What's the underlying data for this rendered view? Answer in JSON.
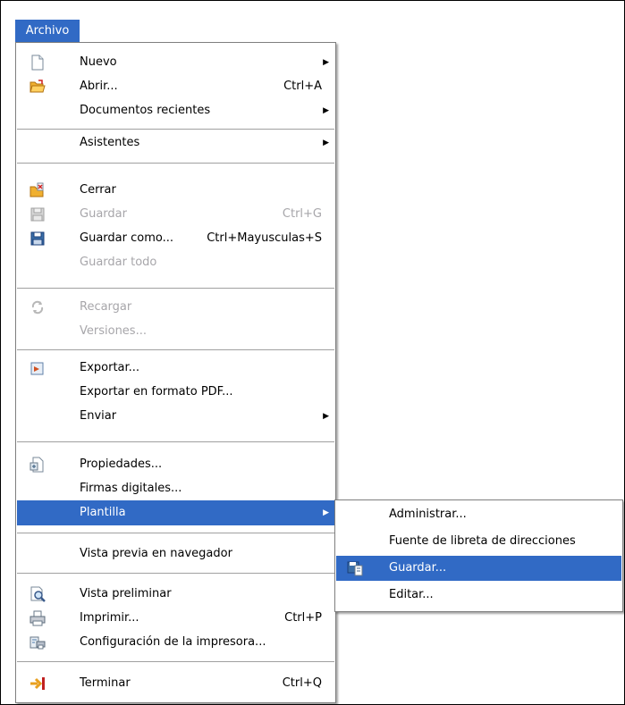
{
  "menubar": {
    "archivo": "Archivo"
  },
  "file_menu": {
    "nuevo": "Nuevo",
    "abrir": "Abrir...",
    "abrir_shortcut": "Ctrl+A",
    "documentos_recientes": "Documentos recientes",
    "asistentes": "Asistentes",
    "cerrar": "Cerrar",
    "guardar": "Guardar",
    "guardar_shortcut": "Ctrl+G",
    "guardar_como": "Guardar como...",
    "guardar_como_shortcut": "Ctrl+Mayusculas+S",
    "guardar_todo": "Guardar todo",
    "recargar": "Recargar",
    "versiones": "Versiones...",
    "exportar": "Exportar...",
    "exportar_pdf": "Exportar en formato PDF...",
    "enviar": "Enviar",
    "propiedades": "Propiedades...",
    "firmas_digitales": "Firmas digitales...",
    "plantilla": "Plantilla",
    "vista_previa_navegador": "Vista previa en navegador",
    "vista_preliminar": "Vista preliminar",
    "imprimir": "Imprimir...",
    "imprimir_shortcut": "Ctrl+P",
    "configuracion_impresora": "Configuración de la impresora...",
    "terminar": "Terminar",
    "terminar_shortcut": "Ctrl+Q"
  },
  "template_submenu": {
    "administrar": "Administrar...",
    "fuente_libreta": "Fuente de libreta de direcciones",
    "guardar": "Guardar...",
    "editar": "Editar..."
  },
  "colors": {
    "highlight": "#316ac5",
    "disabled_text": "#a7a6aa"
  }
}
